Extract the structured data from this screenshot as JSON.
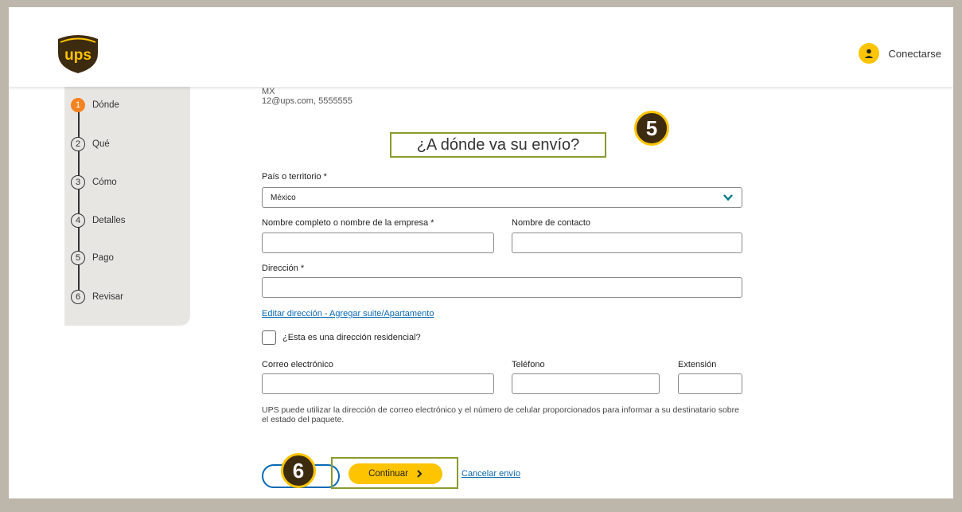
{
  "header": {
    "login_label": "Conectarse"
  },
  "stepper": {
    "steps": [
      {
        "num": "1",
        "label": "Dónde",
        "active": true
      },
      {
        "num": "2",
        "label": "Qué"
      },
      {
        "num": "3",
        "label": "Cómo"
      },
      {
        "num": "4",
        "label": "Detalles"
      },
      {
        "num": "5",
        "label": "Pago"
      },
      {
        "num": "6",
        "label": "Revisar"
      }
    ]
  },
  "origin": {
    "country_line": "MX",
    "contact_line": "12@ups.com, 5555555"
  },
  "form": {
    "title": "¿A dónde va su envío?",
    "country_label": "País o territorio *",
    "country_value": "México",
    "name_label": "Nombre completo o nombre de la empresa *",
    "contact_label": "Nombre de contacto",
    "address_label": "Dirección *",
    "edit_address_link": "Editar dirección - Agregar suite/Apartamento",
    "residential_label": "¿Esta es una dirección residencial?",
    "email_label": "Correo electrónico",
    "phone_label": "Teléfono",
    "extension_label": "Extensión",
    "note": "UPS puede utilizar la dirección de correo electrónico y el número de celular proporcionados para informar a su destinatario sobre el estado del paquete."
  },
  "actions": {
    "continue_label": "Continuar",
    "cancel_label": "Cancelar envío"
  },
  "annotations": {
    "badge_5": "5",
    "badge_6": "6"
  },
  "colors": {
    "brand_brown": "#3d2b10",
    "brand_yellow": "#ffc400",
    "active_step": "#f58220",
    "link_blue": "#0a69b4",
    "highlight_frame": "#8a9a2e"
  }
}
